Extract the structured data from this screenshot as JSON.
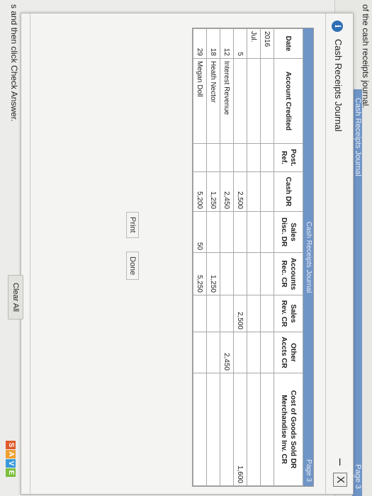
{
  "top_text": "of the cash receipts journal.",
  "top_bar": {
    "title": "Cash Receipts Journal",
    "page": "Page 3"
  },
  "dialog": {
    "title": "Cash Receipts Journal",
    "info_icon": "i",
    "minimize_icon": "–",
    "close_icon": "X"
  },
  "journal": {
    "header_title": "Cash Receipts Journal",
    "page_label": "Page 3",
    "columns": [
      "Date",
      "Account Credited",
      "Post. Ref.",
      "Cash DR",
      "Sales Disc. DR",
      "Accounts Rec. CR",
      "Sales Rev. CR",
      "Other Accts CR",
      "Cost of Goods Sold DR Merchandise Inv. CR"
    ],
    "rows": [
      {
        "date": "2016",
        "account": "",
        "ref": "",
        "cash": "",
        "disc": "",
        "ar": "",
        "sales": "",
        "other": "",
        "cogs": ""
      },
      {
        "date": "Jul.",
        "account": "",
        "ref": "",
        "cash": "",
        "disc": "",
        "ar": "",
        "sales": "",
        "other": "",
        "cogs": ""
      },
      {
        "date": "5",
        "account": "",
        "ref": "",
        "cash": "2,500",
        "disc": "",
        "ar": "",
        "sales": "2,500",
        "other": "",
        "cogs": "1,600"
      },
      {
        "date": "12",
        "account": "Interest Revenue",
        "ref": "",
        "cash": "2,450",
        "disc": "",
        "ar": "",
        "sales": "",
        "other": "2,450",
        "cogs": ""
      },
      {
        "date": "18",
        "account": "Heath Nector",
        "ref": "",
        "cash": "1,250",
        "disc": "",
        "ar": "1,250",
        "sales": "",
        "other": "",
        "cogs": ""
      },
      {
        "date": "29",
        "account": "Megan Doll",
        "ref": "",
        "cash": "5,200",
        "disc": "50",
        "ar": "5,250",
        "sales": "",
        "other": "",
        "cogs": ""
      }
    ]
  },
  "buttons": {
    "print": "Print",
    "done": "Done",
    "clear_all": "Clear All"
  },
  "below_text": "s and then click Check Answer.",
  "logo": [
    "S",
    "A",
    "V",
    "E"
  ],
  "colors": {
    "accent_blue": "#6f94c6",
    "info_blue": "#2f6fb5"
  }
}
